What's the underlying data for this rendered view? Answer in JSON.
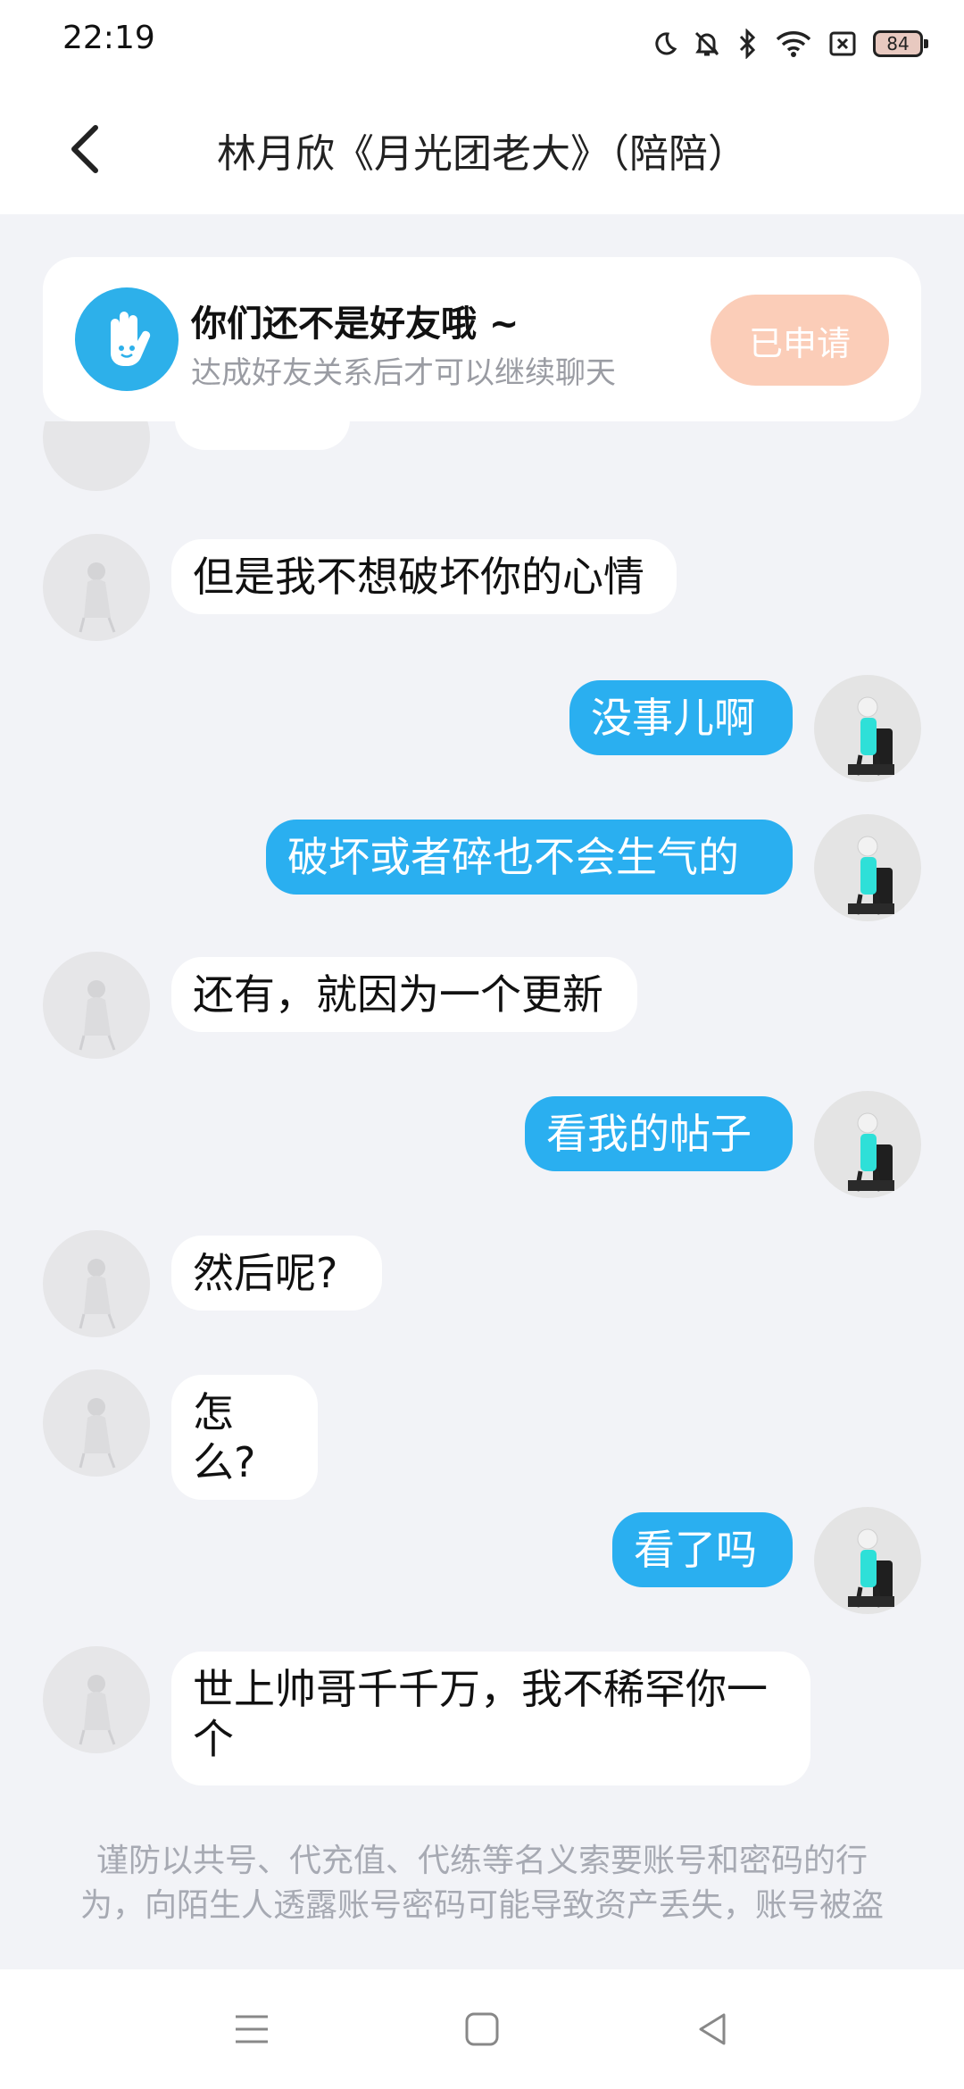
{
  "status_bar": {
    "time": "22:19",
    "battery": "84",
    "icons": [
      "moon-icon",
      "bell-off-icon",
      "bluetooth-icon",
      "wifi-icon",
      "sim-x-icon",
      "battery-icon"
    ]
  },
  "header": {
    "title": "林月欣《月光团老大》（陪陪）",
    "back_icon": "chevron-left-icon"
  },
  "banner": {
    "title": "你们还不是好友哦 ~",
    "subtitle": "达成好友关系后才可以继续聊天",
    "button_label": "已申请",
    "logo_icon": "hand-logo-icon"
  },
  "messages": [
    {
      "side": "in",
      "text": "但是我不想破坏你的心情"
    },
    {
      "side": "out",
      "text": "没事儿啊"
    },
    {
      "side": "out",
      "text": "破坏或者碎也不会生气的"
    },
    {
      "side": "in",
      "text": "还有，就因为一个更新"
    },
    {
      "side": "out",
      "text": "看我的帖子"
    },
    {
      "side": "in",
      "text": "然后呢?"
    },
    {
      "side": "in",
      "text": "怎么?"
    },
    {
      "side": "out",
      "text": "看了吗"
    },
    {
      "side": "in",
      "text": "世上帅哥千千万，我不稀罕你一个"
    }
  ],
  "notice": {
    "line1": "谨防以共号、代充值、代练等名义索要账号和密码的行",
    "line2": "为，向陌生人透露账号密码可能导致资产丢失，账号被盗"
  },
  "colors": {
    "accent": "#2aaff0",
    "banner_button": "#fbcdb8",
    "background": "#f2f3f7"
  },
  "nav": {
    "icons": [
      "menu-icon",
      "home-square-icon",
      "back-triangle-icon"
    ]
  }
}
